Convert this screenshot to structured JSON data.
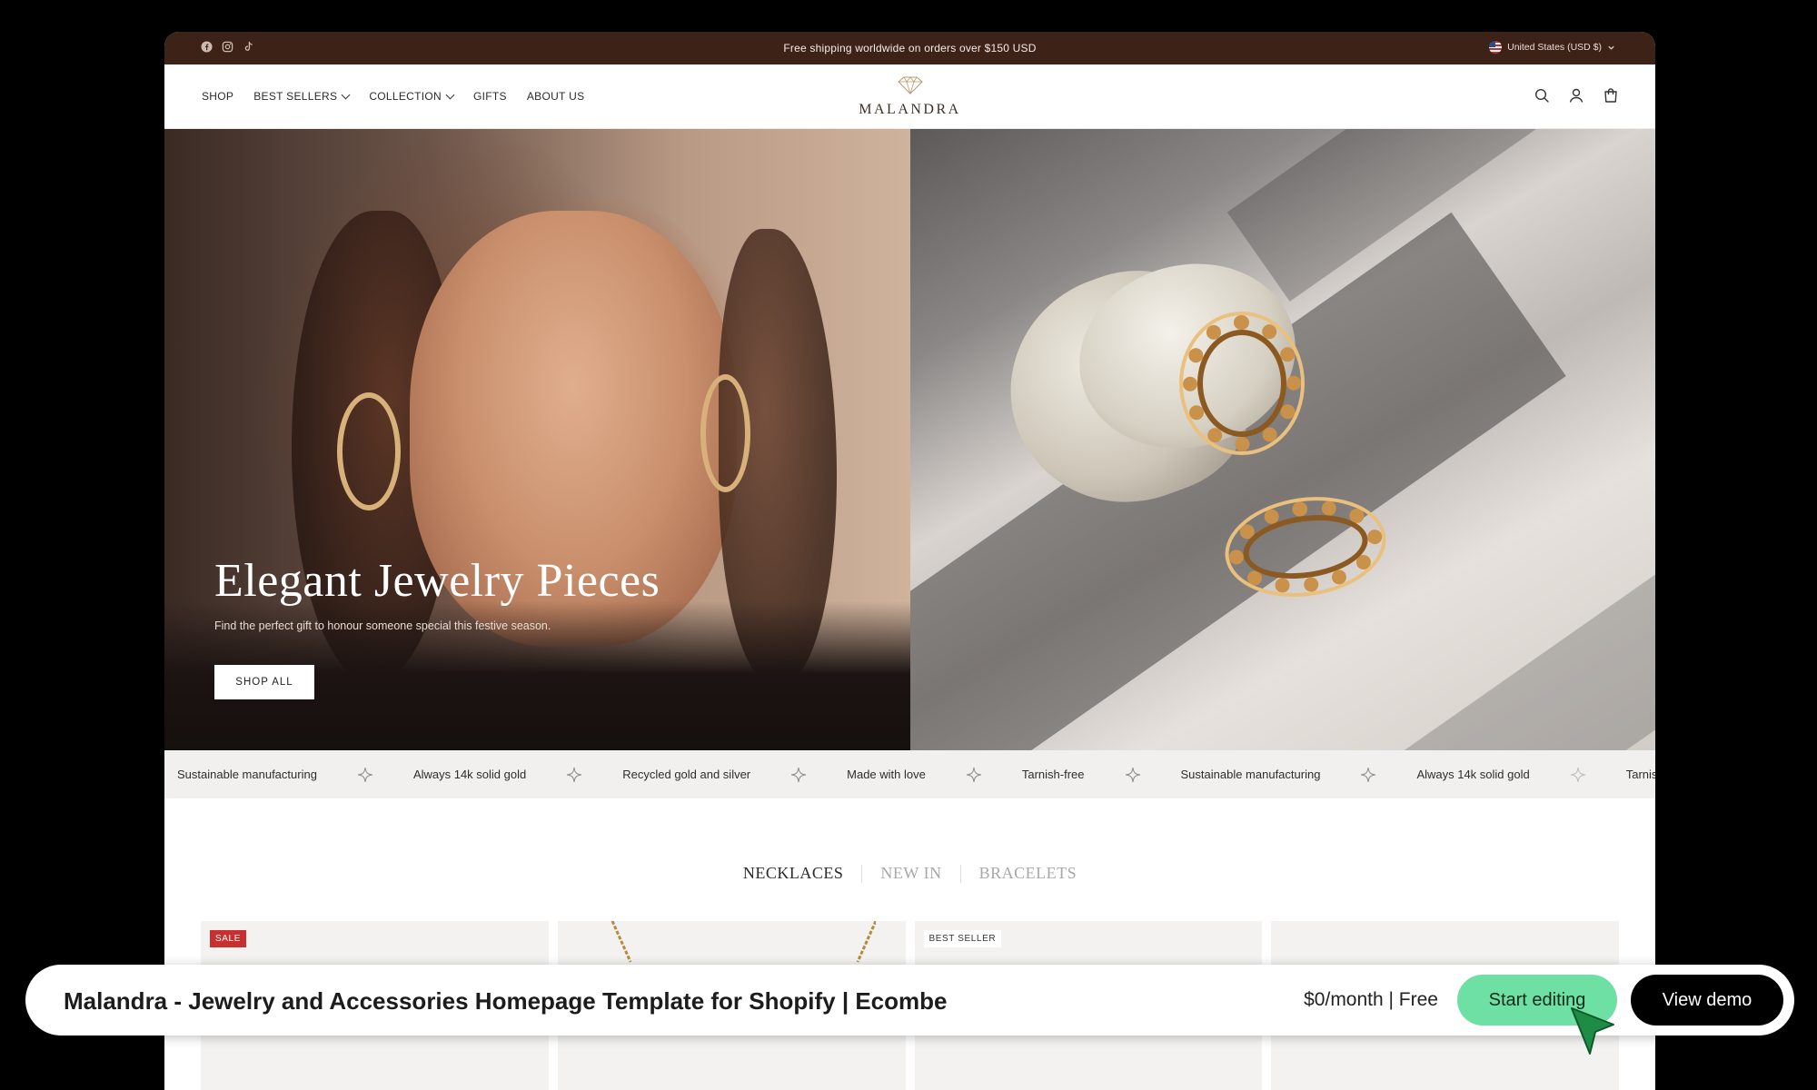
{
  "announcement": {
    "text": "Free shipping worldwide on orders over $150 USD",
    "region": "United States (USD $)"
  },
  "social_icons": [
    "facebook-icon",
    "instagram-icon",
    "tiktok-icon"
  ],
  "nav": {
    "items": [
      {
        "label": "SHOP",
        "dropdown": false
      },
      {
        "label": "BEST SELLERS",
        "dropdown": true
      },
      {
        "label": "COLLECTION",
        "dropdown": true
      },
      {
        "label": "GIFTS",
        "dropdown": false
      },
      {
        "label": "ABOUT US",
        "dropdown": false
      }
    ]
  },
  "brand": {
    "name": "MALANDRA"
  },
  "header_icons": [
    "search-icon",
    "account-icon",
    "cart-icon"
  ],
  "hero": {
    "title": "Elegant Jewelry Pieces",
    "subtitle": "Find the perfect gift to honour someone special this festive season.",
    "cta": "SHOP ALL"
  },
  "marquee": [
    "Sustainable manufacturing",
    "Always 14k solid gold",
    "Recycled gold and silver",
    "Made with love",
    "Tarnish-free",
    "Sustainable manufacturing",
    "Always 14k solid gold",
    "Tarnish-free"
  ],
  "tabs": [
    {
      "label": "NECKLACES",
      "active": true
    },
    {
      "label": "NEW IN",
      "active": false
    },
    {
      "label": "BRACELETS",
      "active": false
    }
  ],
  "products": [
    {
      "badge": "SALE",
      "badge_color": "#c8302f"
    },
    {
      "badge": ""
    },
    {
      "badge": "BEST SELLER",
      "badge_color": "#ffffff"
    },
    {
      "badge": ""
    }
  ],
  "promo": {
    "title": "Malandra - Jewelry and Accessories Homepage Template for Shopify | Ecombe",
    "price": "$0/month | Free",
    "start_label": "Start editing",
    "demo_label": "View demo"
  },
  "colors": {
    "announce_bg": "#3d2218",
    "accent_green": "#6fe0a4",
    "cursor_green": "#1e8c45"
  }
}
